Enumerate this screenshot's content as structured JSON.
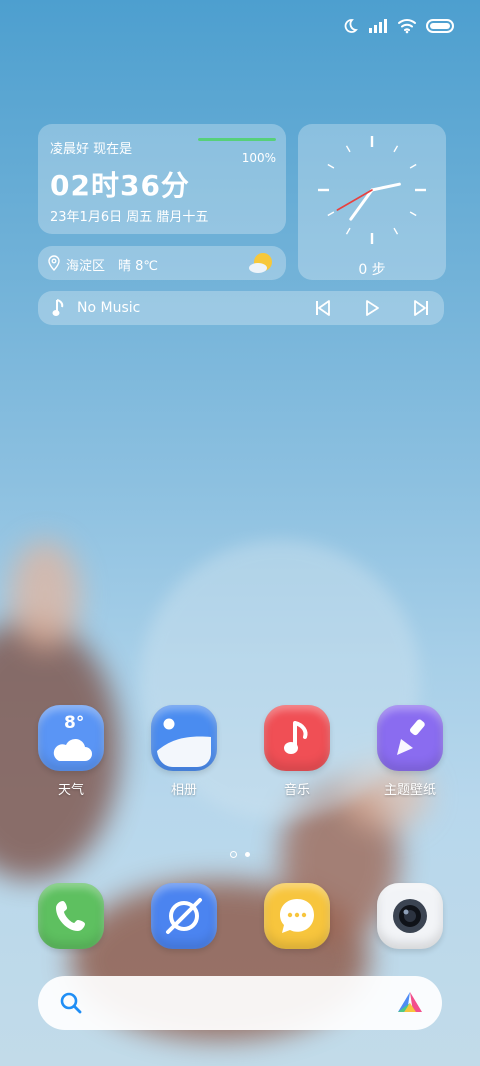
{
  "status_bar": {
    "icons": [
      "moon-icon",
      "signal-icon",
      "wifi-icon",
      "battery-icon"
    ]
  },
  "greeting_widget": {
    "greeting": "凌晨好 现在是",
    "battery_percent": "100%",
    "battery_level": 1.0,
    "time": "02时36分",
    "date": "23年1月6日 周五 腊月十五",
    "bar_color": "#57d07a"
  },
  "weather_widget": {
    "location": "海淀区",
    "condition": "晴 8℃"
  },
  "clock_widget": {
    "steps": "0 步",
    "hour": 2,
    "minute": 36,
    "second": 40
  },
  "music_widget": {
    "title": "No Music"
  },
  "apps": [
    {
      "label": "天气",
      "icon": "weather-icon",
      "temp": "8°",
      "color": "#5a95f5"
    },
    {
      "label": "相册",
      "icon": "gallery-icon",
      "color": "#4a8cf0"
    },
    {
      "label": "音乐",
      "icon": "music-icon",
      "color": "#f04f55"
    },
    {
      "label": "主题壁纸",
      "icon": "theme-brush-icon",
      "color": "#8a6cf0"
    }
  ],
  "dock": [
    {
      "icon": "phone-icon",
      "color": "#5ec060"
    },
    {
      "icon": "browser-icon",
      "color": "#4b84f0"
    },
    {
      "icon": "messages-icon",
      "color": "#f7c53d"
    },
    {
      "icon": "camera-icon",
      "color": "#f2f4f7"
    }
  ],
  "page_indicator": {
    "count": 2,
    "active": 0
  }
}
